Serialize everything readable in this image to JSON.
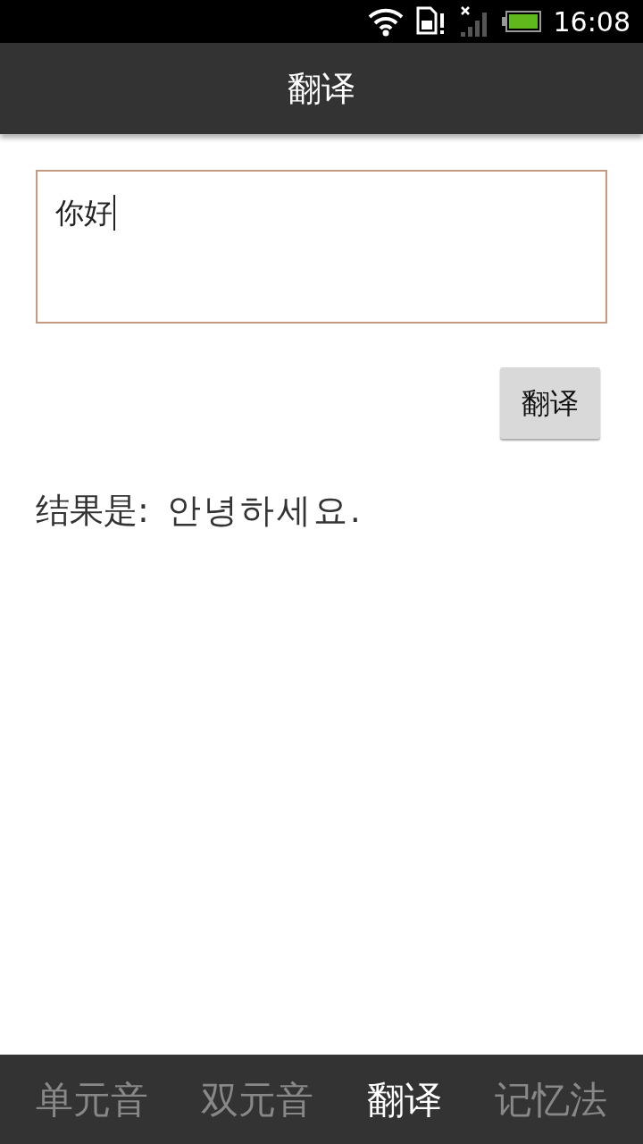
{
  "status_bar": {
    "time": "16:08"
  },
  "title": "翻译",
  "input": {
    "value": "你好",
    "focused": true
  },
  "translate_button": "翻译",
  "result": {
    "label": "结果是:",
    "value": "안녕하세요."
  },
  "tabs": [
    {
      "label": "单元音",
      "selected": false
    },
    {
      "label": "双元音",
      "selected": false
    },
    {
      "label": "翻译",
      "selected": true
    },
    {
      "label": "记忆法",
      "selected": false
    }
  ]
}
